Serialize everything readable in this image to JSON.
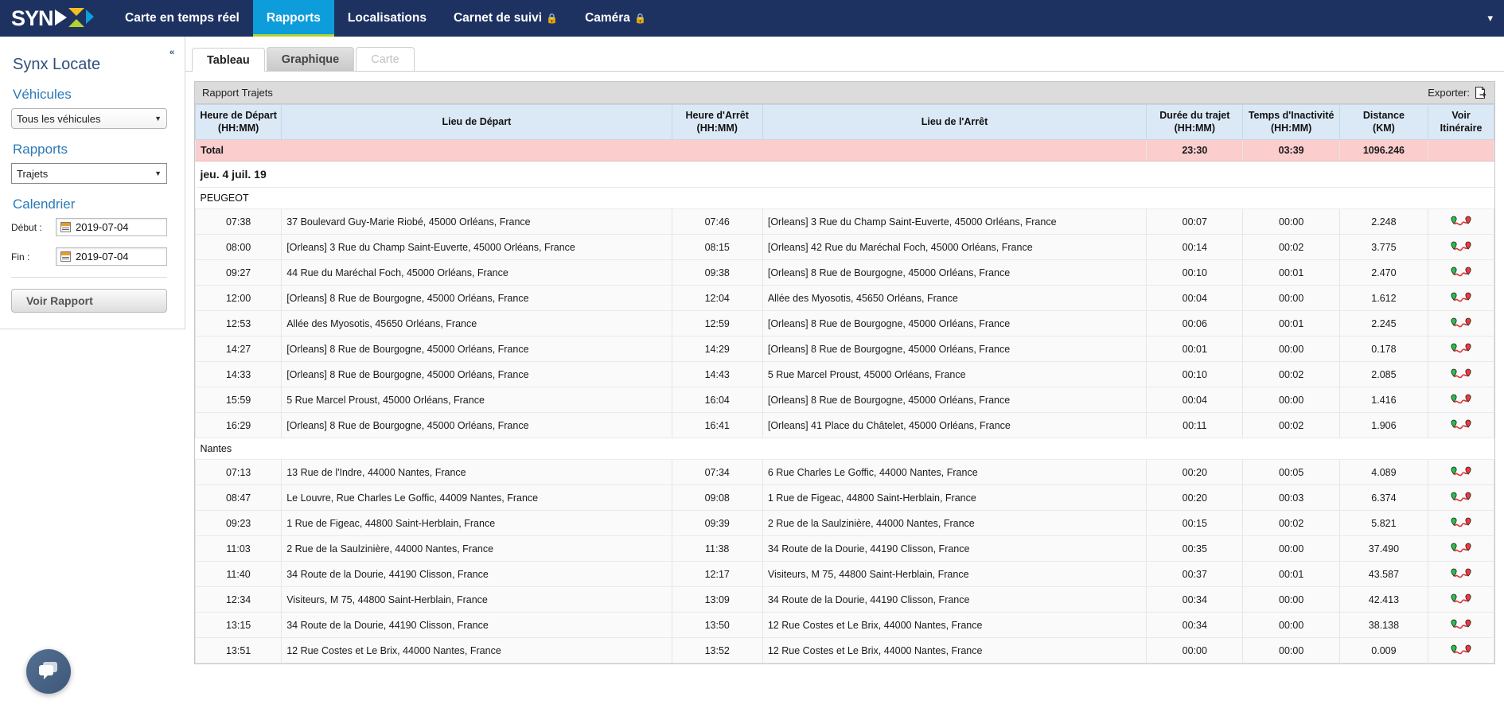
{
  "nav": {
    "logo_text": "SYNX",
    "items": [
      {
        "label": "Carte en temps réel",
        "locked": false,
        "active": false
      },
      {
        "label": "Rapports",
        "locked": false,
        "active": true
      },
      {
        "label": "Localisations",
        "locked": false,
        "active": false
      },
      {
        "label": "Carnet de suivi",
        "locked": true,
        "active": false
      },
      {
        "label": "Caméra",
        "locked": true,
        "active": false
      }
    ],
    "caret_icon": "chevron-down-icon",
    "lock_icon": "lock-icon"
  },
  "sidebar": {
    "title": "Synx Locate",
    "collapse_label": "«",
    "vehicles_heading": "Véhicules",
    "vehicles_value": "Tous les véhicules",
    "reports_heading": "Rapports",
    "reports_value": "Trajets",
    "calendar_heading": "Calendrier",
    "start_label": "Début :",
    "start_value": "2019-07-04",
    "end_label": "Fin :",
    "end_value": "2019-07-04",
    "submit_label": "Voir Rapport"
  },
  "tabs": [
    {
      "label": "Tableau",
      "state": "active"
    },
    {
      "label": "Graphique",
      "state": "hover"
    },
    {
      "label": "Carte",
      "state": "disabled"
    }
  ],
  "report": {
    "title": "Rapport Trajets",
    "export_label": "Exporter:",
    "export_icon": "export-file-icon",
    "columns": [
      "Heure de Départ\n(HH:MM)",
      "Lieu de Départ",
      "Heure d'Arrêt\n(HH:MM)",
      "Lieu de l'Arrêt",
      "Durée du trajet\n(HH:MM)",
      "Temps d'Inactivité\n(HH:MM)",
      "Distance\n(KM)",
      "Voir\nItinéraire"
    ],
    "columns_line1": [
      "Heure de Départ",
      "Lieu de Départ",
      "Heure d'Arrêt",
      "Lieu de l'Arrêt",
      "Durée du trajet",
      "Temps d'Inactivité",
      "Distance",
      "Voir"
    ],
    "columns_line2": [
      "(HH:MM)",
      "",
      "(HH:MM)",
      "",
      "(HH:MM)",
      "(HH:MM)",
      "(KM)",
      "Itinéraire"
    ],
    "total": {
      "label": "Total",
      "duration": "23:30",
      "idle": "03:39",
      "distance": "1096.246"
    },
    "date_group": "jeu. 4 juil. 19",
    "route_icon": "route-pins-icon",
    "groups": [
      {
        "name": "PEUGEOT",
        "rows": [
          {
            "start_time": "07:38",
            "start_place": "37 Boulevard Guy-Marie Riobé, 45000 Orléans, France",
            "stop_time": "07:46",
            "stop_place": "[Orleans] 3 Rue du Champ Saint-Euverte, 45000 Orléans, France",
            "duration": "00:07",
            "idle": "00:00",
            "distance": "2.248"
          },
          {
            "start_time": "08:00",
            "start_place": "[Orleans] 3 Rue du Champ Saint-Euverte, 45000 Orléans, France",
            "stop_time": "08:15",
            "stop_place": "[Orleans] 42 Rue du Maréchal Foch, 45000 Orléans, France",
            "duration": "00:14",
            "idle": "00:02",
            "distance": "3.775"
          },
          {
            "start_time": "09:27",
            "start_place": "44 Rue du Maréchal Foch, 45000 Orléans, France",
            "stop_time": "09:38",
            "stop_place": "[Orleans] 8 Rue de Bourgogne, 45000 Orléans, France",
            "duration": "00:10",
            "idle": "00:01",
            "distance": "2.470"
          },
          {
            "start_time": "12:00",
            "start_place": "[Orleans] 8 Rue de Bourgogne, 45000 Orléans, France",
            "stop_time": "12:04",
            "stop_place": "Allée des Myosotis, 45650 Orléans, France",
            "duration": "00:04",
            "idle": "00:00",
            "distance": "1.612"
          },
          {
            "start_time": "12:53",
            "start_place": "Allée des Myosotis, 45650 Orléans, France",
            "stop_time": "12:59",
            "stop_place": "[Orleans] 8 Rue de Bourgogne, 45000 Orléans, France",
            "duration": "00:06",
            "idle": "00:01",
            "distance": "2.245"
          },
          {
            "start_time": "14:27",
            "start_place": "[Orleans] 8 Rue de Bourgogne, 45000 Orléans, France",
            "stop_time": "14:29",
            "stop_place": "[Orleans] 8 Rue de Bourgogne, 45000 Orléans, France",
            "duration": "00:01",
            "idle": "00:00",
            "distance": "0.178"
          },
          {
            "start_time": "14:33",
            "start_place": "[Orleans] 8 Rue de Bourgogne, 45000 Orléans, France",
            "stop_time": "14:43",
            "stop_place": "5 Rue Marcel Proust, 45000 Orléans, France",
            "duration": "00:10",
            "idle": "00:02",
            "distance": "2.085"
          },
          {
            "start_time": "15:59",
            "start_place": "5 Rue Marcel Proust, 45000 Orléans, France",
            "stop_time": "16:04",
            "stop_place": "[Orleans] 8 Rue de Bourgogne, 45000 Orléans, France",
            "duration": "00:04",
            "idle": "00:00",
            "distance": "1.416"
          },
          {
            "start_time": "16:29",
            "start_place": "[Orleans] 8 Rue de Bourgogne, 45000 Orléans, France",
            "stop_time": "16:41",
            "stop_place": "[Orleans] 41 Place du Châtelet, 45000 Orléans, France",
            "duration": "00:11",
            "idle": "00:02",
            "distance": "1.906"
          }
        ]
      },
      {
        "name": "Nantes",
        "rows": [
          {
            "start_time": "07:13",
            "start_place": "13 Rue de l'Indre, 44000 Nantes, France",
            "stop_time": "07:34",
            "stop_place": "6 Rue Charles Le Goffic, 44000 Nantes, France",
            "duration": "00:20",
            "idle": "00:05",
            "distance": "4.089"
          },
          {
            "start_time": "08:47",
            "start_place": "Le Louvre, Rue Charles Le Goffic, 44009 Nantes, France",
            "stop_time": "09:08",
            "stop_place": "1 Rue de Figeac, 44800 Saint-Herblain, France",
            "duration": "00:20",
            "idle": "00:03",
            "distance": "6.374"
          },
          {
            "start_time": "09:23",
            "start_place": "1 Rue de Figeac, 44800 Saint-Herblain, France",
            "stop_time": "09:39",
            "stop_place": "2 Rue de la Saulzinière, 44000 Nantes, France",
            "duration": "00:15",
            "idle": "00:02",
            "distance": "5.821"
          },
          {
            "start_time": "11:03",
            "start_place": "2 Rue de la Saulzinière, 44000 Nantes, France",
            "stop_time": "11:38",
            "stop_place": "34 Route de la Dourie, 44190 Clisson, France",
            "duration": "00:35",
            "idle": "00:00",
            "distance": "37.490"
          },
          {
            "start_time": "11:40",
            "start_place": "34 Route de la Dourie, 44190 Clisson, France",
            "stop_time": "12:17",
            "stop_place": "Visiteurs, M 75, 44800 Saint-Herblain, France",
            "duration": "00:37",
            "idle": "00:01",
            "distance": "43.587"
          },
          {
            "start_time": "12:34",
            "start_place": "Visiteurs, M 75, 44800 Saint-Herblain, France",
            "stop_time": "13:09",
            "stop_place": "34 Route de la Dourie, 44190 Clisson, France",
            "duration": "00:34",
            "idle": "00:00",
            "distance": "42.413"
          },
          {
            "start_time": "13:15",
            "start_place": "34 Route de la Dourie, 44190 Clisson, France",
            "stop_time": "13:50",
            "stop_place": "12 Rue Costes et Le Brix, 44000 Nantes, France",
            "duration": "00:34",
            "idle": "00:00",
            "distance": "38.138"
          },
          {
            "start_time": "13:51",
            "start_place": "12 Rue Costes et Le Brix, 44000 Nantes, France",
            "stop_time": "13:52",
            "stop_place": "12 Rue Costes et Le Brix, 44000 Nantes, France",
            "duration": "00:00",
            "idle": "00:00",
            "distance": "0.009"
          }
        ]
      }
    ]
  },
  "chat": {
    "icon": "chat-bubble-icon"
  },
  "colors": {
    "navbar": "#1e3262",
    "nav_active": "#0d9ddb",
    "nav_underline": "#b2d234",
    "header_blue": "#dbe9f7",
    "total_pink": "#fbcdcd",
    "link_blue": "#2a7ab9"
  }
}
